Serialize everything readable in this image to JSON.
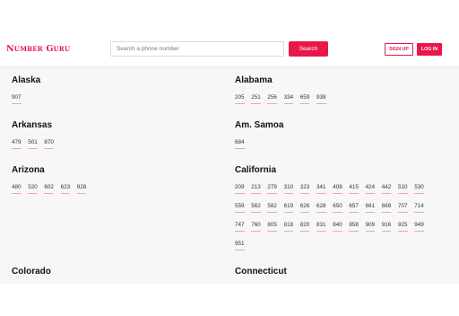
{
  "header": {
    "logo": "Number Guru",
    "search_placeholder": "Search a phone number",
    "search_button": "Search",
    "signup": "SIGN UP",
    "login": "LOG IN"
  },
  "states": [
    {
      "name": "Alaska",
      "codes": [
        "907"
      ]
    },
    {
      "name": "Alabama",
      "codes": [
        "205",
        "251",
        "256",
        "334",
        "659",
        "938"
      ]
    },
    {
      "name": "Arkansas",
      "codes": [
        "479",
        "501",
        "870"
      ]
    },
    {
      "name": "Am. Samoa",
      "codes": [
        "684"
      ]
    },
    {
      "name": "Arizona",
      "codes": [
        "480",
        "520",
        "602",
        "623",
        "928"
      ]
    },
    {
      "name": "California",
      "codes": [
        "209",
        "213",
        "279",
        "310",
        "323",
        "341",
        "408",
        "415",
        "424",
        "442",
        "510",
        "530",
        "559",
        "562",
        "582",
        "619",
        "626",
        "628",
        "650",
        "657",
        "661",
        "669",
        "707",
        "714",
        "747",
        "760",
        "805",
        "818",
        "820",
        "831",
        "840",
        "858",
        "909",
        "916",
        "925",
        "949",
        "951"
      ]
    },
    {
      "name": "Colorado",
      "codes": []
    },
    {
      "name": "Connecticut",
      "codes": []
    }
  ]
}
